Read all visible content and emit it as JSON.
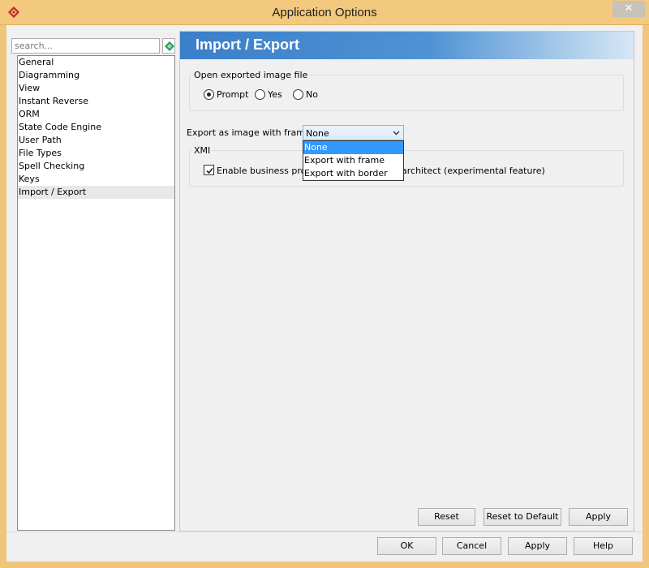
{
  "window": {
    "title": "Application Options",
    "close_glyph": "✕",
    "app_icon": "diamond-logo-icon"
  },
  "colors": {
    "title_bar": "#f2c97d",
    "header_blue": "#3a7fc8",
    "selection_blue": "#3399ff"
  },
  "sidebar": {
    "search_placeholder": "search...",
    "search_icon": "search-go-icon",
    "selected_index": 10,
    "items": [
      {
        "label": "General"
      },
      {
        "label": "Diagramming"
      },
      {
        "label": "View"
      },
      {
        "label": "Instant Reverse"
      },
      {
        "label": "ORM"
      },
      {
        "label": "State Code Engine"
      },
      {
        "label": "User Path"
      },
      {
        "label": "File Types"
      },
      {
        "label": "Spell Checking"
      },
      {
        "label": "Keys"
      },
      {
        "label": "Import / Export"
      }
    ]
  },
  "panel": {
    "title": "Import / Export",
    "open_image_group": {
      "legend": "Open exported image file",
      "options": [
        {
          "label": "Prompt",
          "checked": true
        },
        {
          "label": "Yes",
          "checked": false
        },
        {
          "label": "No",
          "checked": false
        }
      ]
    },
    "export_frame": {
      "label": "Export as image with frame :",
      "selected": "None",
      "options": [
        "None",
        "Export with frame",
        "Export with border"
      ],
      "highlighted_index": 0
    },
    "xmi_group": {
      "legend": "XMI",
      "checkbox_checked": true,
      "checkbox_label_left": "Enable business proce",
      "checkbox_label_right": "architect (experimental feature)"
    },
    "buttons": {
      "reset": "Reset",
      "reset_default": "Reset to Default",
      "apply": "Apply"
    }
  },
  "footer": {
    "ok": "OK",
    "cancel": "Cancel",
    "apply": "Apply",
    "help": "Help"
  }
}
